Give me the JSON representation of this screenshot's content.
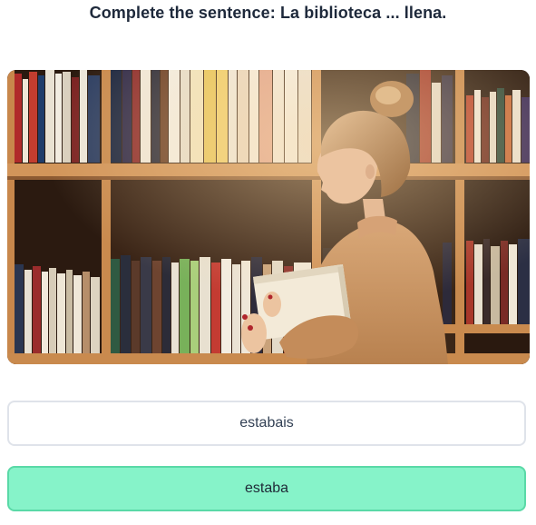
{
  "question": {
    "text": "Complete the sentence: La biblioteca ... llena."
  },
  "image": {
    "subject": "woman browsing books in a library"
  },
  "options": [
    {
      "label": "estabais",
      "state": "default"
    },
    {
      "label": "estaba",
      "state": "selected"
    }
  ],
  "colors": {
    "selected_fill": "#86f3c9",
    "selected_border": "#5ad9a7",
    "default_border": "#dfe3ea"
  }
}
